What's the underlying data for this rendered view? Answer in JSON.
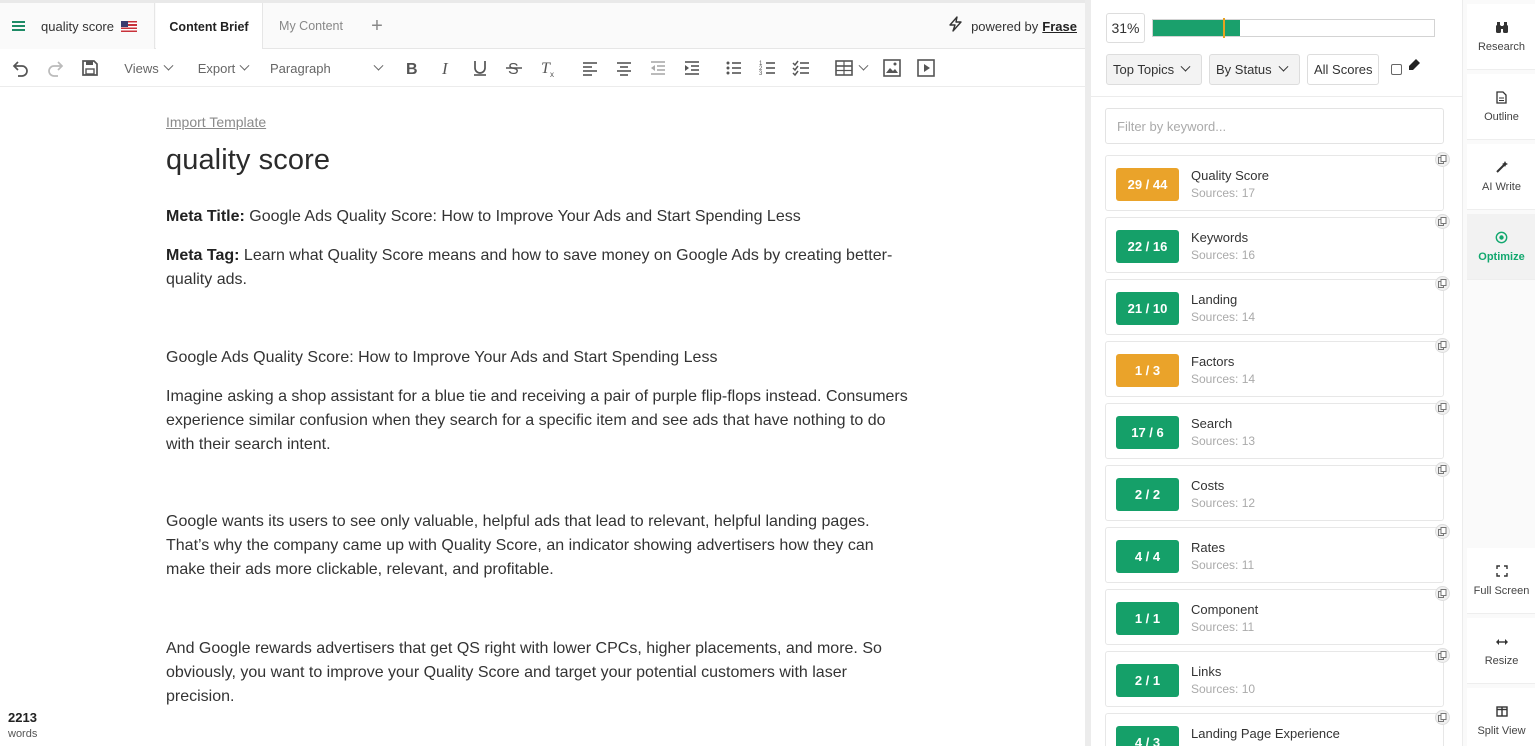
{
  "tabs": {
    "doc_title": "quality score",
    "brief": "Content Brief",
    "my_content": "My Content",
    "add": "+",
    "powered_prefix": "powered by",
    "powered_brand": "Frase"
  },
  "toolbar": {
    "views": "Views",
    "export": "Export",
    "paragraph": "Paragraph"
  },
  "editor": {
    "import_template": "Import Template",
    "title": "quality score",
    "meta_title_label": "Meta Title:",
    "meta_title": " Google Ads Quality Score: How to Improve Your Ads and Start Spending Less",
    "meta_tag_label": "Meta Tag:",
    "meta_tag": " Learn what Quality Score means and how to save money on Google Ads by creating better-quality ads.",
    "paragraphs": [
      "Google Ads Quality Score: How to Improve Your Ads and Start Spending Less",
      "Imagine asking a shop assistant for a blue tie and receiving a pair of purple flip-flops instead. Consumers experience similar confusion when they search for a specific item and see ads that have nothing to do with their search intent.",
      "Google wants its users to see only valuable, helpful ads that lead to relevant, helpful landing pages. That’s why the company came up with Quality Score, an indicator showing advertisers how they can make their ads more clickable, relevant, and profitable.",
      "And Google rewards advertisers that get QS right with lower CPCs, higher placements, and more. So obviously, you want to improve your Quality Score and target your potential customers with laser precision."
    ],
    "word_count": "2213",
    "word_label": "words"
  },
  "panel": {
    "score_percent": "31%",
    "score_fill": 0.31,
    "score_target": 0.25,
    "filter_topics": "Top Topics",
    "filter_status": "By Status",
    "filter_scores": "All Scores",
    "filter_placeholder": "Filter by keyword...",
    "colors": {
      "green": "#15a069",
      "orange": "#eaa32a"
    },
    "topics": [
      {
        "score": "29 / 44",
        "name": "Quality Score",
        "sources": "Sources: 17",
        "status": "orange"
      },
      {
        "score": "22 / 16",
        "name": "Keywords",
        "sources": "Sources: 16",
        "status": "green"
      },
      {
        "score": "21 / 10",
        "name": "Landing",
        "sources": "Sources: 14",
        "status": "green"
      },
      {
        "score": "1 / 3",
        "name": "Factors",
        "sources": "Sources: 14",
        "status": "orange"
      },
      {
        "score": "17 / 6",
        "name": "Search",
        "sources": "Sources: 13",
        "status": "green"
      },
      {
        "score": "2 / 2",
        "name": "Costs",
        "sources": "Sources: 12",
        "status": "green"
      },
      {
        "score": "4 / 4",
        "name": "Rates",
        "sources": "Sources: 11",
        "status": "green"
      },
      {
        "score": "1 / 1",
        "name": "Component",
        "sources": "Sources: 11",
        "status": "green"
      },
      {
        "score": "2 / 1",
        "name": "Links",
        "sources": "Sources: 10",
        "status": "green"
      },
      {
        "score": "4 / 3",
        "name": "Landing Page Experience",
        "sources": "",
        "status": "green"
      }
    ]
  },
  "nav": {
    "research": "Research",
    "outline": "Outline",
    "ai_write": "AI Write",
    "optimize": "Optimize",
    "full_screen": "Full Screen",
    "resize": "Resize",
    "split_view": "Split View"
  }
}
